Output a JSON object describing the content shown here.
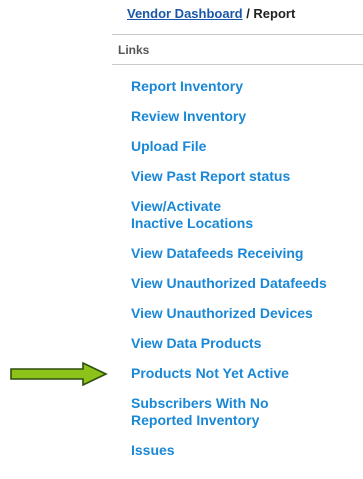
{
  "breadcrumb": {
    "link": "Vendor Dashboard",
    "separator": " / ",
    "current": "Report"
  },
  "section": {
    "title": "Links"
  },
  "links": [
    "Report Inventory",
    "Review Inventory",
    "Upload File",
    "View Past Report status",
    "View/Activate\nInactive Locations",
    "View Datafeeds Receiving",
    "View Unauthorized Datafeeds",
    "View Unauthorized Devices",
    "View Data Products",
    "Products Not Yet Active",
    "Subscribers With No\nReported Inventory",
    "Issues"
  ],
  "colors": {
    "link": "#1a88d6",
    "breadcrumb_link": "#1a57a8",
    "arrow_fill": "#8cc21a",
    "arrow_stroke": "#2f4f0e"
  },
  "annotation": {
    "icon": "arrow-right-icon",
    "points_to_link_index": 9
  }
}
